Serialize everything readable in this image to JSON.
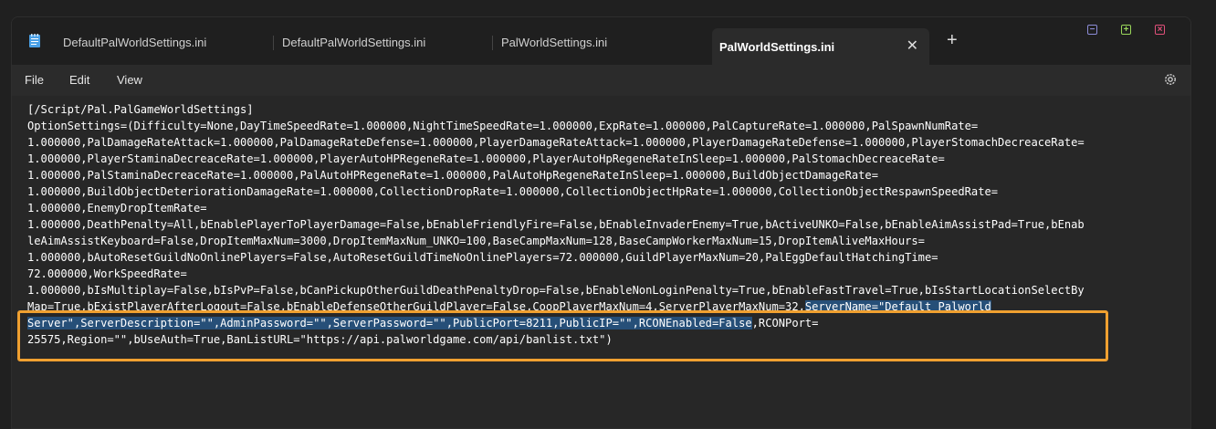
{
  "tabs": [
    {
      "label": "DefaultPalWorldSettings.ini"
    },
    {
      "label": "DefaultPalWorldSettings.ini"
    },
    {
      "label": "PalWorldSettings.ini"
    },
    {
      "label": "PalWorldSettings.ini"
    }
  ],
  "menu": {
    "file": "File",
    "edit": "Edit",
    "view": "View"
  },
  "editor": {
    "lines": [
      "[/Script/Pal.PalGameWorldSettings]",
      "OptionSettings=(Difficulty=None,DayTimeSpeedRate=1.000000,NightTimeSpeedRate=1.000000,ExpRate=1.000000,PalCaptureRate=1.000000,PalSpawnNumRate=",
      "1.000000,PalDamageRateAttack=1.000000,PalDamageRateDefense=1.000000,PlayerDamageRateAttack=1.000000,PlayerDamageRateDefense=1.000000,PlayerStomachDecreaceRate=",
      "1.000000,PlayerStaminaDecreaceRate=1.000000,PlayerAutoHPRegeneRate=1.000000,PlayerAutoHpRegeneRateInSleep=1.000000,PalStomachDecreaceRate=",
      "1.000000,PalStaminaDecreaceRate=1.000000,PalAutoHPRegeneRate=1.000000,PalAutoHpRegeneRateInSleep=1.000000,BuildObjectDamageRate=",
      "1.000000,BuildObjectDeteriorationDamageRate=1.000000,CollectionDropRate=1.000000,CollectionObjectHpRate=1.000000,CollectionObjectRespawnSpeedRate=",
      "1.000000,EnemyDropItemRate=",
      "1.000000,DeathPenalty=All,bEnablePlayerToPlayerDamage=False,bEnableFriendlyFire=False,bEnableInvaderEnemy=True,bActiveUNKO=False,bEnableAimAssistPad=True,bEnab",
      "leAimAssistKeyboard=False,DropItemMaxNum=3000,DropItemMaxNum_UNKO=100,BaseCampMaxNum=128,BaseCampWorkerMaxNum=15,DropItemAliveMaxHours=",
      "1.000000,bAutoResetGuildNoOnlinePlayers=False,AutoResetGuildTimeNoOnlinePlayers=72.000000,GuildPlayerMaxNum=20,PalEggDefaultHatchingTime=",
      "72.000000,WorkSpeedRate=",
      "1.000000,bIsMultiplay=False,bIsPvP=False,bCanPickupOtherGuildDeathPenaltyDrop=False,bEnableNonLoginPenalty=True,bEnableFastTravel=True,bIsStartLocationSelectBy"
    ],
    "line13_pre": "Map=True,bExistPlayerAfterLogout=False,bEnableDefenseOtherGuildPlayer=False,CoopPlayerMaxNum=4,ServerPlayerMaxNum=32,",
    "line13_hl": "ServerName=\"Default Palworld",
    "line14_hl": "Server\",ServerDescription=\"\",AdminPassword=\"\",ServerPassword=\"\",PublicPort=8211,PublicIP=\"\",RCONEnabled=False",
    "line14_post": ",RCONPort=",
    "line15": "25575,Region=\"\",bUseAuth=True,BanListURL=\"https://api.palworldgame.com/api/banlist.txt\")"
  },
  "colors": {
    "highlight_box": "#f0a030",
    "selection": "#264f78"
  }
}
